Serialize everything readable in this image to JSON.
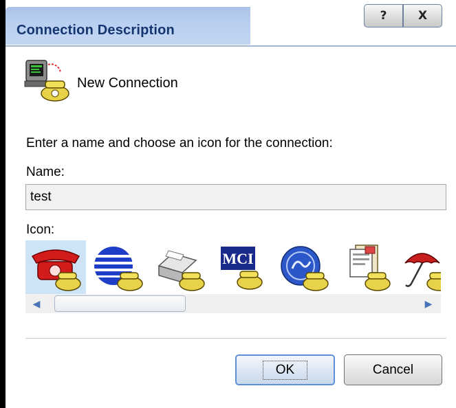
{
  "window": {
    "title": "Connection Description",
    "help_glyph": "?",
    "close_glyph": "X"
  },
  "connection": {
    "icon": "modem-phone-icon",
    "label": "New Connection"
  },
  "form": {
    "prompt": "Enter a name and choose an icon for the connection:",
    "name_label": "Name:",
    "name_value": "test",
    "icon_label": "Icon:"
  },
  "icons": [
    {
      "name": "red-telephone-icon",
      "selected": true
    },
    {
      "name": "blue-globe-stripes-icon",
      "selected": false
    },
    {
      "name": "fax-machine-icon",
      "selected": false
    },
    {
      "name": "mci-logo-icon",
      "selected": false,
      "text": "MCI"
    },
    {
      "name": "ge-globe-icon",
      "selected": false
    },
    {
      "name": "documents-icon",
      "selected": false
    },
    {
      "name": "umbrella-icon",
      "selected": false
    }
  ],
  "buttons": {
    "ok": "OK",
    "cancel": "Cancel"
  },
  "colors": {
    "title_text": "#15356f",
    "selected_icon_bg": "#cde4f6",
    "ok_border": "#5f8ed8"
  }
}
